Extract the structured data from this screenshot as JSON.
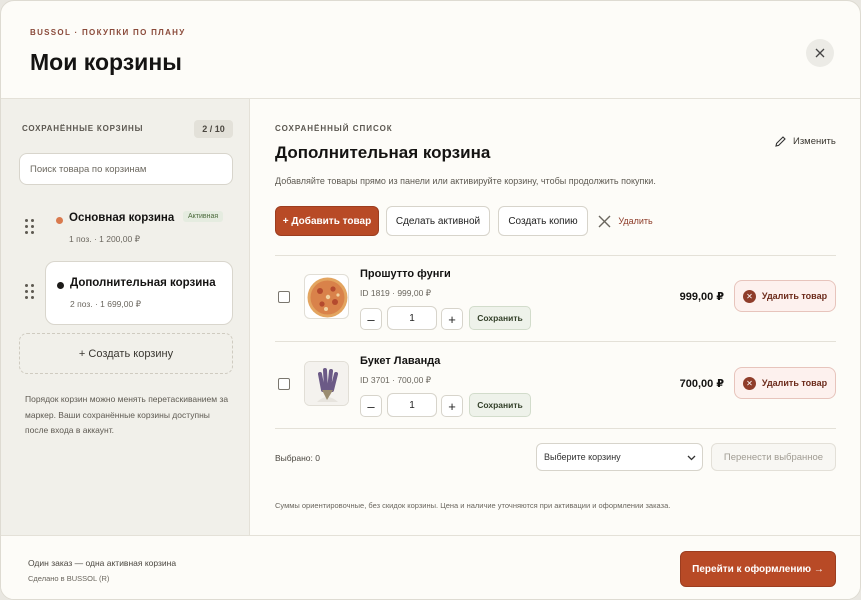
{
  "header": {
    "eyebrow": "BUSSOL · ПОКУПКИ ПО ПЛАНУ",
    "title": "Мои корзины",
    "close_icon": "close-icon"
  },
  "sidebar": {
    "heading": "СОХРАНЁННЫЕ КОРЗИНЫ",
    "count": "2 / 10",
    "search_placeholder": "Поиск товара по корзинам",
    "carts": [
      {
        "name": "Основная корзина",
        "meta": "1 поз. · 1 200,00 ₽",
        "badge": "Активная",
        "dot_color": "#d97a4e"
      },
      {
        "name": "Дополнительная корзина",
        "meta": "2 поз. · 1 699,00 ₽",
        "dot_color": "#1c1b19"
      }
    ],
    "create_label": "+ Создать корзину",
    "note": "Порядок корзин можно менять перетаскиванием за маркер. Ваши сохранённые корзины доступны после входа в аккаунт."
  },
  "main": {
    "eyebrow": "СОХРАНЁННЫЙ СПИСОК",
    "title": "Дополнительная корзина",
    "edit_label": "Изменить",
    "description": "Добавляйте товары прямо из панели или активируйте корзину, чтобы продолжить покупки.",
    "actions": {
      "add": "+ Добавить товар",
      "make_active": "Сделать активной",
      "copy": "Создать копию",
      "delete": "Удалить"
    },
    "items": [
      {
        "name": "Прошутто фунги",
        "id_line": "ID 1819 · 999,00 ₽",
        "qty": "1",
        "save": "Сохранить",
        "price": "999,00 ₽",
        "remove": "Удалить товар"
      },
      {
        "name": "Букет Лаванда",
        "id_line": "ID 3701 · 700,00 ₽",
        "qty": "1",
        "save": "Сохранить",
        "price": "700,00 ₽",
        "remove": "Удалить товар"
      }
    ],
    "selected": "Выбрано: 0",
    "select_placeholder": "Выберите корзину",
    "transfer": "Перенести выбранное",
    "disclaimer": "Суммы ориентировочные, без скидок корзины. Цена и наличие уточняются при активации и оформлении заказа."
  },
  "footer": {
    "line1": "Один заказ — одна активная корзина",
    "line2": "Сделано в BUSSOL (R)",
    "checkout": "Перейти к оформлению →"
  },
  "colors": {
    "accent": "#b84a26",
    "active_badge_bg": "#e5ece0",
    "danger": "#8f3d2a"
  }
}
